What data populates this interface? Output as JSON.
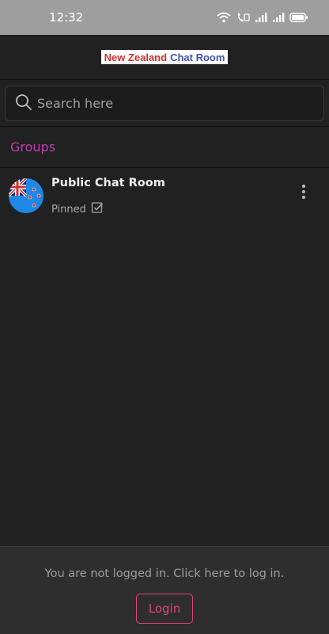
{
  "status_bar": {
    "time": "12:32",
    "icons": [
      "wifi-icon",
      "volte-icon",
      "signal-icon",
      "signal-icon",
      "battery-icon"
    ]
  },
  "header": {
    "logo_part1": "New Zealand",
    "logo_part2": "Chat Room",
    "logo_colors": {
      "part1": "#d32f2f",
      "part2": "#3f51b5"
    }
  },
  "search": {
    "placeholder": "Search here",
    "value": ""
  },
  "groups_section": {
    "title": "Groups",
    "title_color": "#c13fb0",
    "items": [
      {
        "title": "Public Chat Room",
        "status": "Pinned",
        "avatar": "new-zealand-flag",
        "status_icon": "checkbox-checked-icon",
        "menu_icon": "more-vertical-icon"
      }
    ]
  },
  "login_panel": {
    "message": "You are not logged in. Click here to log in.",
    "button_label": "Login",
    "accent_color": "#e0457b"
  }
}
